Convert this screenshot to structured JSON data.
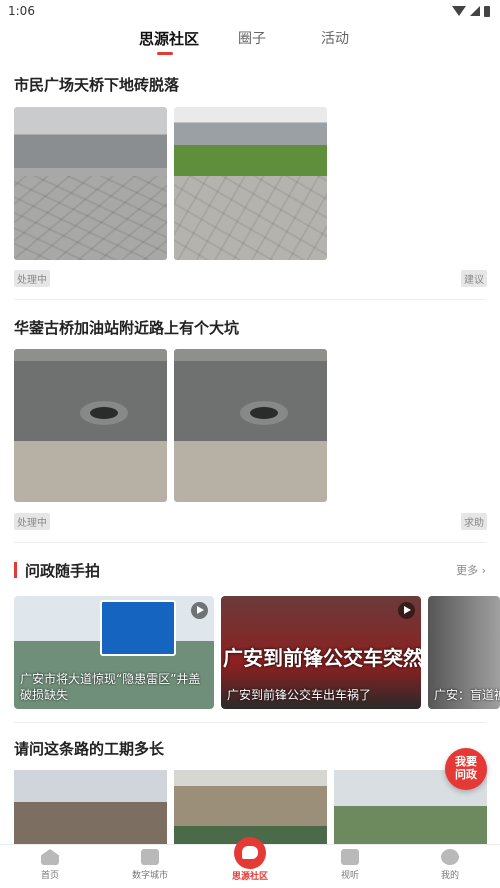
{
  "status_bar": {
    "time": "1:06"
  },
  "top_tabs": [
    {
      "label": "思源社区",
      "active": true
    },
    {
      "label": "圈子",
      "active": false
    },
    {
      "label": "活动",
      "active": false
    }
  ],
  "posts": [
    {
      "title": "市民广场天桥下地砖脱落",
      "status": "处理中",
      "category": "建议"
    },
    {
      "title": "华蓥古桥加油站附近路上有个大坑",
      "status": "处理中",
      "category": "求助"
    },
    {
      "title": "请问这条路的工期多长"
    }
  ],
  "section": {
    "title": "问政随手拍",
    "more_label": "更多"
  },
  "videos": [
    {
      "caption": "广安市将大道惊现“隐患雷区”井盖破损缺失"
    },
    {
      "caption": "广安到前锋公交车出车祸了",
      "banner": "广安到前锋公交车突然事故"
    },
    {
      "caption": "广安：盲道被"
    }
  ],
  "fab": {
    "label_line1": "我要",
    "label_line2": "问政"
  },
  "bottom_nav": [
    {
      "label": "首页",
      "icon": "home-icon"
    },
    {
      "label": "数字城市",
      "icon": "city-icon"
    },
    {
      "label": "思源社区",
      "icon": "community-icon",
      "active": true
    },
    {
      "label": "视听",
      "icon": "video-icon"
    },
    {
      "label": "我的",
      "icon": "profile-icon"
    }
  ],
  "colors": {
    "accent": "#e53935",
    "tag_bg": "#e6e6e6",
    "text": "#222222",
    "muted": "#888888"
  }
}
